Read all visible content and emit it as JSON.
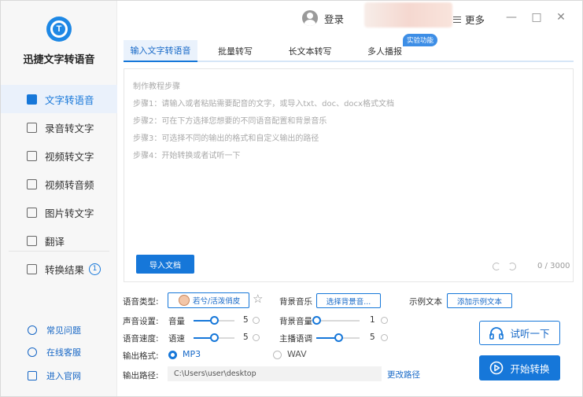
{
  "app": {
    "title": "迅捷文字转语音",
    "logo_letter": "T"
  },
  "sidebar": {
    "items": [
      {
        "label": "文字转语音",
        "icon": "text-to-speech-icon",
        "active": true
      },
      {
        "label": "录音转文字",
        "icon": "recording-icon"
      },
      {
        "label": "视频转文字",
        "icon": "video-icon"
      },
      {
        "label": "视频转音频",
        "icon": "video-audio-icon"
      },
      {
        "label": "图片转文字",
        "icon": "image-icon"
      },
      {
        "label": "翻译",
        "icon": "translate-icon"
      },
      {
        "label": "转换结果",
        "icon": "results-icon",
        "badge": "1"
      }
    ],
    "footer": [
      {
        "label": "常见问题",
        "icon": "help-icon"
      },
      {
        "label": "在线客服",
        "icon": "headset-icon"
      },
      {
        "label": "进入官网",
        "icon": "website-icon"
      }
    ]
  },
  "topbar": {
    "login_label": "登录",
    "more_label": "更多",
    "minimize": "—",
    "maximize": "□",
    "close": "✕"
  },
  "tabs": [
    {
      "label": "输入文字转语音",
      "active": true
    },
    {
      "label": "批量转写"
    },
    {
      "label": "长文本转写"
    },
    {
      "label": "多人播报"
    }
  ],
  "experimental_badge": "实验功能",
  "editor": {
    "hints": [
      "制作教程步骤",
      "步骤1：请输入或者粘贴需要配音的文字，或导入txt、doc、docx格式文档",
      "步骤2：可在下方选择您想要的不同语音配置和背景音乐",
      "步骤3：可选择不同的输出的格式和自定义输出的路径",
      "步骤4：开始转换或者试听一下"
    ],
    "import_label": "导入文档",
    "counter": "0 / 3000"
  },
  "settings": {
    "voice_type_label": "语音类型:",
    "voice_name": "若兮/活泼俏皮",
    "bgm_label": "背景音乐",
    "bgm_button": "选择背景音...",
    "sample_text_label": "示例文本",
    "sample_text_button": "添加示例文本",
    "sound_settings_label": "声音设置:",
    "volume_label": "音量",
    "volume_value": "5",
    "volume_level": 0.5,
    "bgm_volume_label": "背景音量",
    "bgm_volume_value": "1",
    "bgm_volume_level": 0.0,
    "speed_group_label": "语音速度:",
    "speed_label": "语速",
    "speed_value": "5",
    "speed_level": 0.5,
    "pitch_label": "主播语调",
    "pitch_value": "5",
    "pitch_level": 0.5,
    "format_label": "输出格式:",
    "format_options": [
      "MP3",
      "WAV"
    ],
    "format_selected": "MP3",
    "path_label": "输出路径:",
    "path_value": "C:\\Users\\user\\desktop",
    "change_path_label": "更改路径"
  },
  "actions": {
    "listen_label": "试听一下",
    "start_label": "开始转换"
  },
  "colors": {
    "accent": "#1677d9",
    "sidebar_bg": "#f7f7f7",
    "active_bg": "#eaf1fb"
  }
}
